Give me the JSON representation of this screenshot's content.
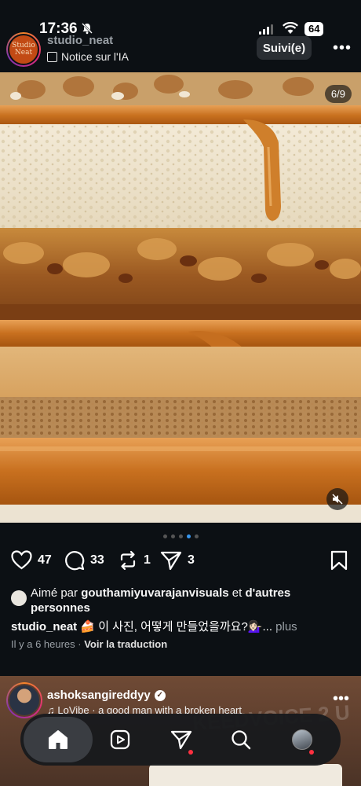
{
  "status_bar": {
    "time": "17:36",
    "battery": "64"
  },
  "post": {
    "username": "studio_neat",
    "avatar_text": "Studio Neat",
    "ai_note": "Notice sur l'IA",
    "follow_label": "Suivi(e)",
    "image_counter": "6/9",
    "carousel_dots": 5,
    "carousel_active_index": 3,
    "actions": {
      "likes": "47",
      "comments": "33",
      "reposts": "1",
      "shares": "3"
    },
    "liked_by_prefix": "Aimé par ",
    "liked_by_user": "gouthamiyuvarajanvisuals",
    "liked_by_suffix": " et ",
    "liked_by_others": "d'autres personnes",
    "caption_user": "studio_neat",
    "caption_text": " 🍰 이 사진, 어떻게 만들었을까요?💁🏻‍♀️...",
    "caption_more": " plus",
    "time_ago": "Il y a 6 heures",
    "separator": " · ",
    "translate_label": "Voir la traduction"
  },
  "next_post": {
    "username": "ashoksangireddyy",
    "music_note": "♫",
    "music": " LoVibe · a good man with a broken heart",
    "background_text": "KEEDVOICE 2 U"
  },
  "bottom_nav": {
    "items": [
      "home",
      "reels",
      "messages",
      "search",
      "profile"
    ]
  },
  "colors": {
    "background": "#0c1014",
    "accent_blue": "#3897f0",
    "notification_red": "#ff3040",
    "caramel": "#c87a2a"
  }
}
